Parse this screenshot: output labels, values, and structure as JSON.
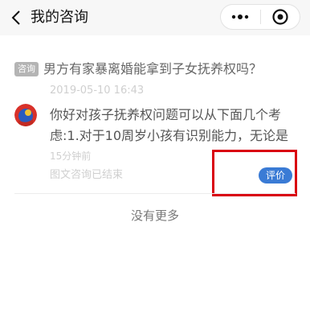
{
  "navbar": {
    "title": "我的咨询",
    "back_icon": "chevron-left-icon",
    "menu_icon": "more-dots-icon",
    "close_icon": "target-circle-icon"
  },
  "consultation": {
    "tag": "咨询",
    "question": "男方有家暴离婚能拿到子女抚养权吗？",
    "date": "2019-05-10 16:43",
    "answer_lines": [
      "你好对孩子抚养权问题可以从下面几个考",
      "虑:1.对于10周岁小孩有识别能力，无论是"
    ],
    "answer_time": "15分钟前",
    "status": "图文咨询已结束",
    "rate_label": "评价"
  },
  "footer": {
    "no_more": "没有更多"
  },
  "colors": {
    "accent": "#3a7bd5",
    "highlight": "#d9000f"
  }
}
